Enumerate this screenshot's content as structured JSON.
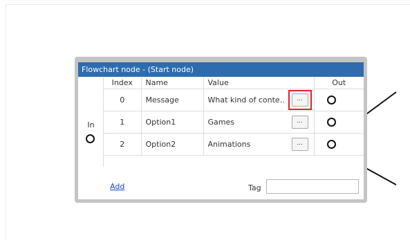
{
  "node": {
    "title": "Flowchart node - (Start node)",
    "in_label": "In",
    "columns": {
      "index": "Index",
      "name": "Name",
      "value": "Value",
      "out": "Out"
    },
    "rows": [
      {
        "index": "0",
        "name": "Message",
        "value": "What kind of conte...",
        "button": "..."
      },
      {
        "index": "1",
        "name": "Option1",
        "value": "Games",
        "button": "..."
      },
      {
        "index": "2",
        "name": "Option2",
        "value": "Animations",
        "button": "..."
      }
    ],
    "add_label": "Add",
    "tag_label": "Tag",
    "tag_value": ""
  },
  "colors": {
    "title_bar": "#2e6cae",
    "frame": "#c4c4c4",
    "highlight": "#e0202a",
    "link": "#1a44d6"
  }
}
